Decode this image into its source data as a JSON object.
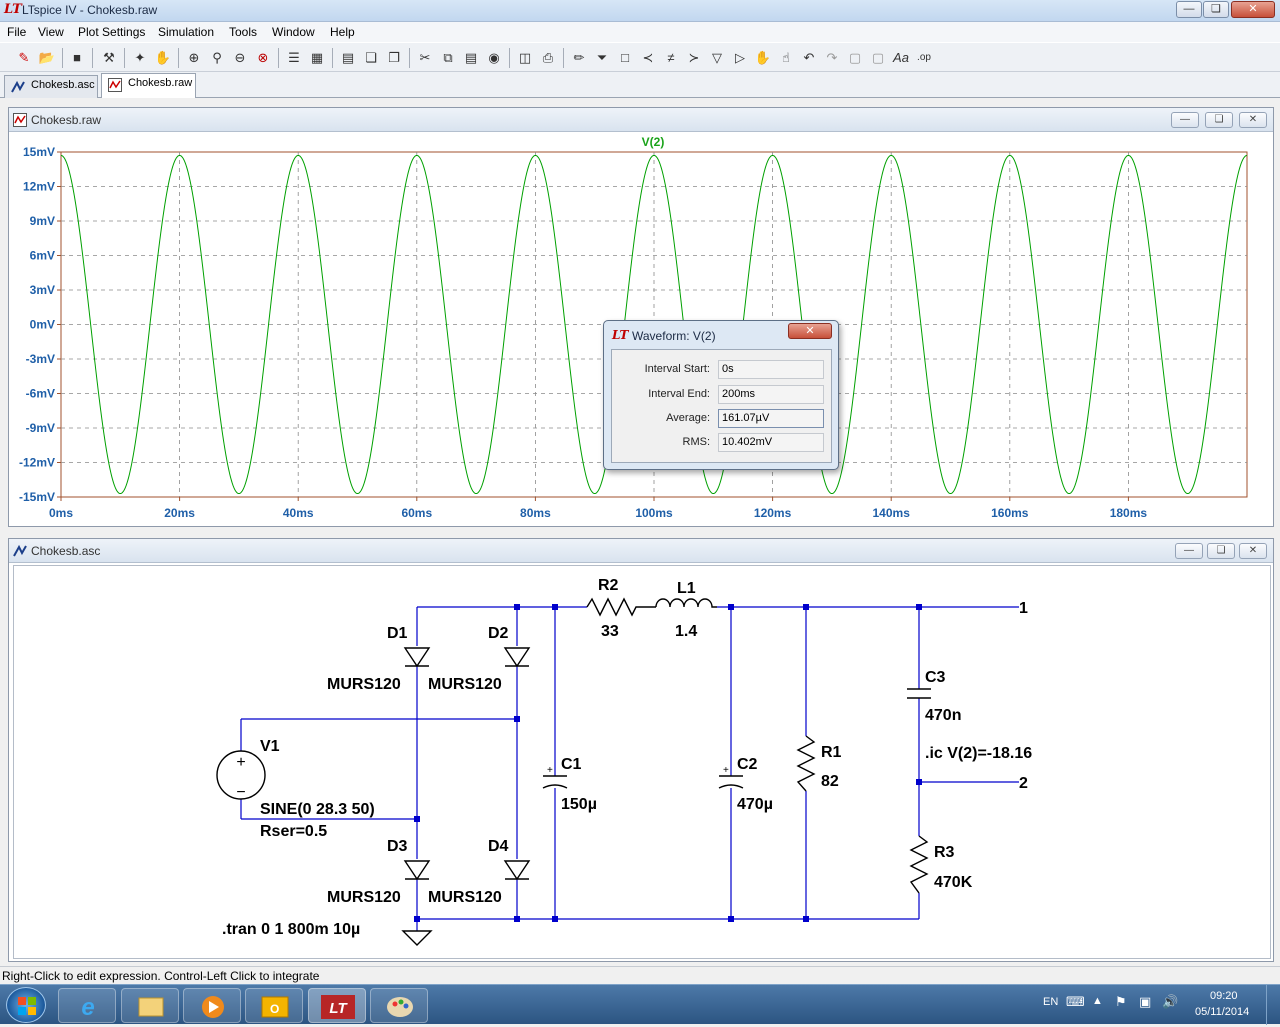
{
  "app": {
    "title": "LTspice IV - Chokesb.raw"
  },
  "menu": [
    "File",
    "View",
    "Plot Settings",
    "Simulation",
    "Tools",
    "Window",
    "Help"
  ],
  "tabs": [
    {
      "label": "Chokesb.asc"
    },
    {
      "label": "Chokesb.raw"
    }
  ],
  "waveform_window": {
    "title": "Chokesb.raw",
    "trace_label": "V(2)"
  },
  "schematic_window": {
    "title": "Chokesb.asc"
  },
  "dialog": {
    "title": "Waveform: V(2)",
    "fields": [
      {
        "label": "Interval Start:",
        "value": "0s"
      },
      {
        "label": "Interval End:",
        "value": "200ms"
      },
      {
        "label": "Average:",
        "value": "161.07µV"
      },
      {
        "label": "RMS:",
        "value": "10.402mV"
      }
    ]
  },
  "chart_data": {
    "type": "line",
    "series": [
      {
        "name": "V(2)",
        "color": "#00a000",
        "frequency_hz": 50,
        "amplitude_mv": 14.7,
        "phase_deg": 90
      }
    ],
    "xlim": [
      0,
      200
    ],
    "x_unit": "ms",
    "ylim": [
      -15,
      15
    ],
    "y_unit": "mV",
    "xticks": [
      "0ms",
      "20ms",
      "40ms",
      "60ms",
      "80ms",
      "100ms",
      "120ms",
      "140ms",
      "160ms",
      "180ms"
    ],
    "yticks": [
      "15mV",
      "12mV",
      "9mV",
      "6mV",
      "3mV",
      "0mV",
      "-3mV",
      "-6mV",
      "-9mV",
      "-12mV",
      "-15mV"
    ],
    "grid": true
  },
  "schematic": {
    "components": {
      "D1": {
        "name": "D1",
        "model": "MURS120"
      },
      "D2": {
        "name": "D2",
        "model": "MURS120"
      },
      "D3": {
        "name": "D3",
        "model": "MURS120"
      },
      "D4": {
        "name": "D4",
        "model": "MURS120"
      },
      "V1": {
        "name": "V1",
        "value": "SINE(0 28.3 50)",
        "rser": "Rser=0.5"
      },
      "R2": {
        "name": "R2",
        "value": "33"
      },
      "L1": {
        "name": "L1",
        "value": "1.4"
      },
      "C1": {
        "name": "C1",
        "value": "150µ"
      },
      "C2": {
        "name": "C2",
        "value": "470µ"
      },
      "R1": {
        "name": "R1",
        "value": "82"
      },
      "C3": {
        "name": "C3",
        "value": "470n"
      },
      "R3": {
        "name": "R3",
        "value": "470K"
      }
    },
    "directives": {
      "tran": ".tran 0 1 800m 10µ",
      "ic": ".ic V(2)=-18.16"
    },
    "node_labels": {
      "n1": "1",
      "n2": "2"
    }
  },
  "status": "Right-Click to edit expression. Control-Left Click to integrate",
  "tray": {
    "lang": "EN",
    "time": "09:20",
    "date": "05/11/2014"
  }
}
